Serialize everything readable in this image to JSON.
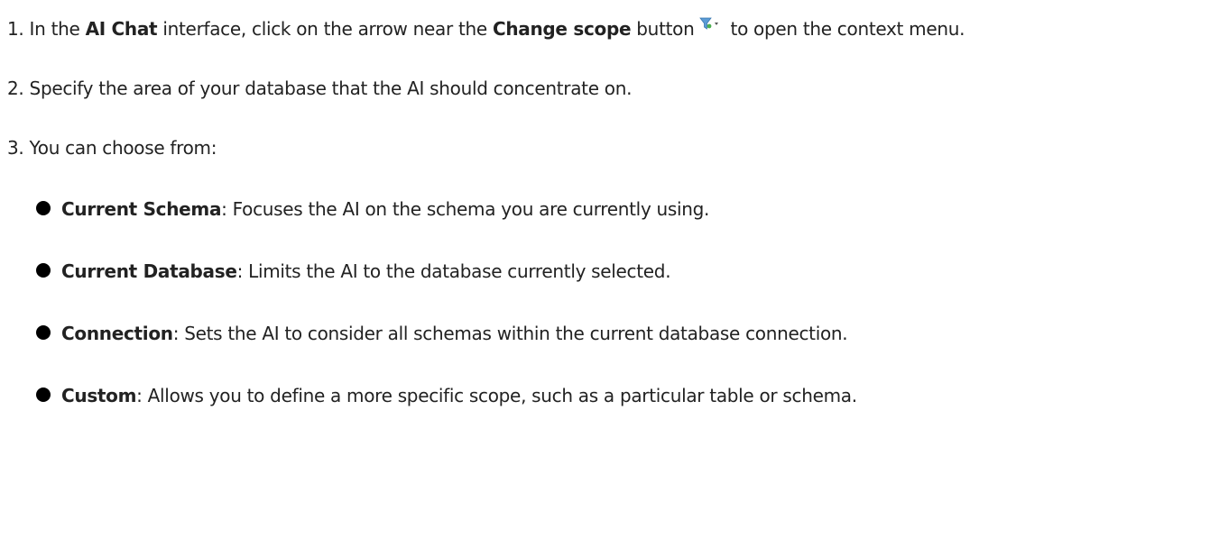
{
  "steps": [
    {
      "number": "1.",
      "parts": {
        "pre": "In the ",
        "bold1": "AI Chat",
        "mid": " interface, click on the arrow near the ",
        "bold2": "Change scope",
        "post_button": " button",
        "post": " to open the context menu."
      }
    },
    {
      "number": "2.",
      "text": "Specify the area of your database that the AI should concentrate on."
    },
    {
      "number": "3.",
      "text": "You can choose from:"
    }
  ],
  "options": [
    {
      "title": "Current Schema",
      "desc": ": Focuses the AI on the schema you are currently using."
    },
    {
      "title": "Current Database",
      "desc": ": Limits the AI to the database currently selected."
    },
    {
      "title": "Connection",
      "desc": ": Sets the AI to consider all schemas within the current database connection."
    },
    {
      "title": "Custom",
      "desc": ": Allows you to define a more specific scope, such as a particular table or schema."
    }
  ],
  "icons": {
    "change_scope": "filter-dropdown-icon"
  },
  "colors": {
    "text": "#222222",
    "bullet": "#000000",
    "filter_icon": "#5b9bd5",
    "filter_icon_dot": "#4caf50"
  }
}
